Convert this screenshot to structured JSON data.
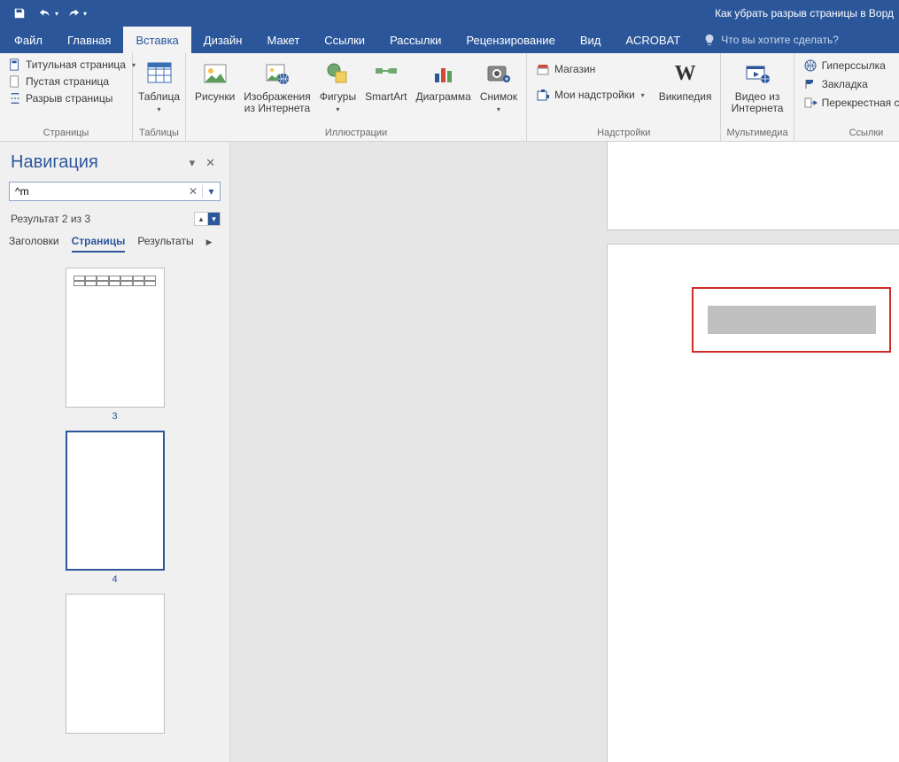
{
  "titlebar": {
    "title": "Как убрать разрыв страницы в Ворд"
  },
  "tabs": {
    "items": [
      "Файл",
      "Главная",
      "Вставка",
      "Дизайн",
      "Макет",
      "Ссылки",
      "Рассылки",
      "Рецензирование",
      "Вид",
      "ACROBAT"
    ],
    "active_index": 2,
    "tell_me": "Что вы хотите сделать?"
  },
  "ribbon": {
    "pages": {
      "label": "Страницы",
      "title_page": "Титульная страница",
      "blank_page": "Пустая страница",
      "page_break": "Разрыв страницы"
    },
    "tables": {
      "label": "Таблицы",
      "table": "Таблица"
    },
    "illustrations": {
      "label": "Иллюстрации",
      "pictures": "Рисунки",
      "online_pictures_l1": "Изображения",
      "online_pictures_l2": "из Интернета",
      "shapes": "Фигуры",
      "smartart": "SmartArt",
      "chart": "Диаграмма",
      "screenshot": "Снимок"
    },
    "addins": {
      "label": "Надстройки",
      "store": "Магазин",
      "my_addins": "Мои надстройки",
      "wikipedia": "Википедия"
    },
    "media": {
      "label": "Мультимедиа",
      "online_video_l1": "Видео из",
      "online_video_l2": "Интернета"
    },
    "links": {
      "label": "Ссылки",
      "hyperlink": "Гиперссылка",
      "bookmark": "Закладка",
      "crossref": "Перекрестная ссылка"
    }
  },
  "nav": {
    "title": "Навигация",
    "search_value": "^m",
    "result": "Результат 2 из 3",
    "tab_headings": "Заголовки",
    "tab_pages": "Страницы",
    "tab_results": "Результаты",
    "thumbs": [
      {
        "num": "3",
        "has_table": true,
        "selected": false
      },
      {
        "num": "4",
        "has_table": false,
        "selected": true
      },
      {
        "num": "",
        "has_table": false,
        "selected": false
      }
    ]
  }
}
